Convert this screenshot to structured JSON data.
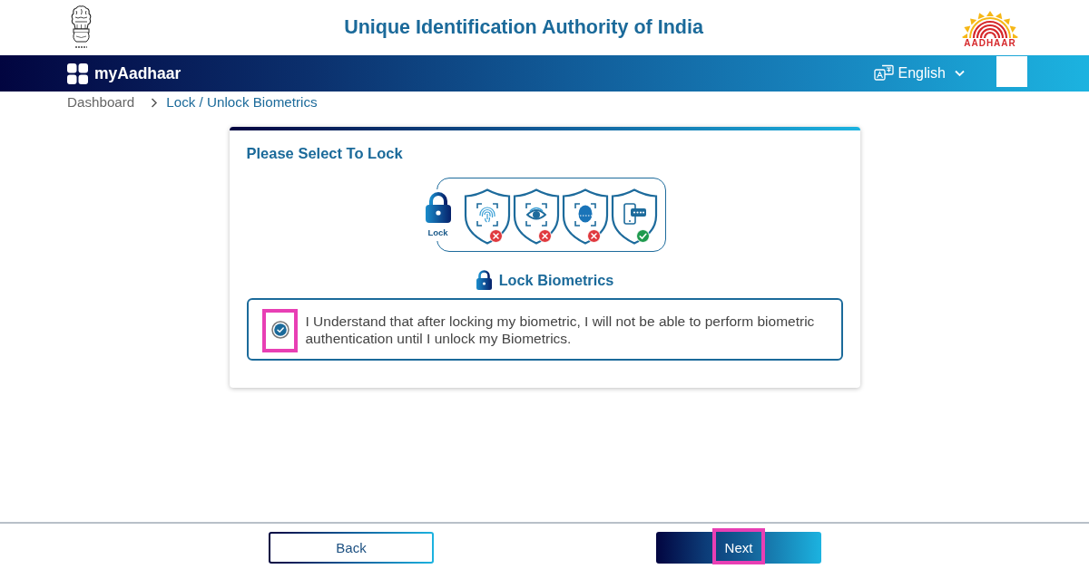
{
  "header": {
    "title": "Unique Identification Authority of India",
    "logo_text": "AADHAAR"
  },
  "navbar": {
    "brand": "myAadhaar",
    "language": "English"
  },
  "breadcrumb": [
    {
      "label": "Dashboard",
      "current": false
    },
    {
      "label": "Lock / Unlock Biometrics",
      "current": true
    }
  ],
  "card": {
    "title": "Please Select To Lock",
    "illustration": {
      "lock_label": "Lock",
      "items": [
        {
          "kind": "fingerprint",
          "locked": true
        },
        {
          "kind": "iris",
          "locked": true
        },
        {
          "kind": "face",
          "locked": true
        },
        {
          "kind": "otp",
          "locked": false
        }
      ]
    },
    "section_title": "Lock Biometrics",
    "consent": {
      "checked": true,
      "highlighted": true,
      "text": "I Understand that after locking my biometric, I will not be able to perform biometric authentication until I unlock my Biometrics."
    }
  },
  "buttons": [
    {
      "label": "Back",
      "kind": "outline",
      "highlighted": false
    },
    {
      "label": "Next",
      "kind": "primary",
      "highlighted": true
    }
  ]
}
